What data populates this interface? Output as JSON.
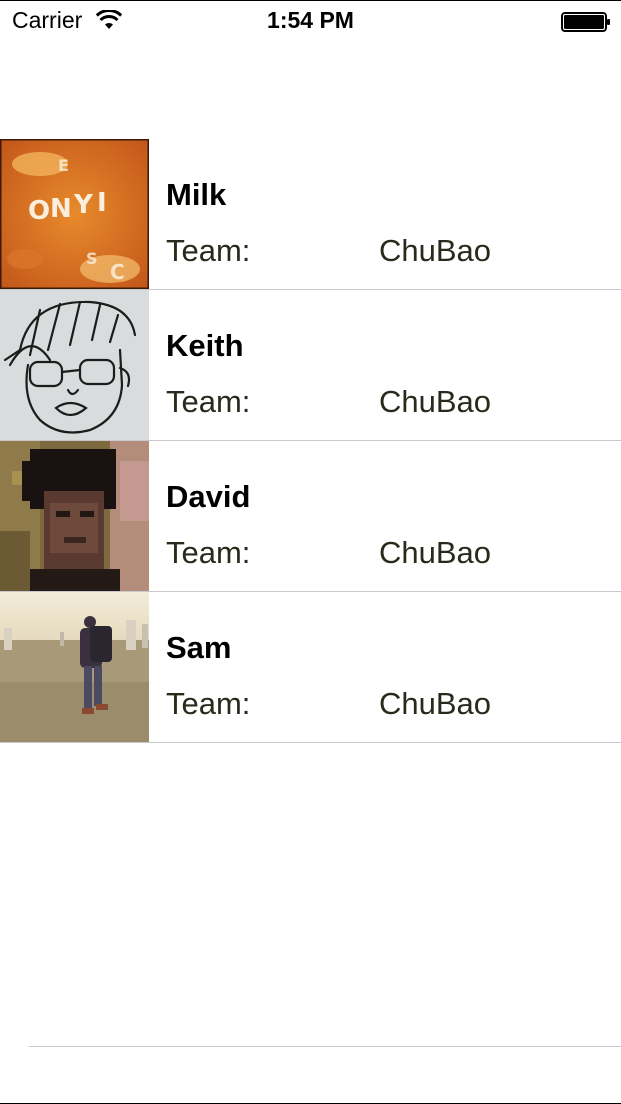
{
  "status_bar": {
    "carrier": "Carrier",
    "time": "1:54 PM",
    "icons": [
      "wifi-icon",
      "battery-icon"
    ]
  },
  "team_label": "Team:",
  "members": [
    {
      "name": "Milk",
      "team": "ChuBao",
      "avatar": "alphabet-soup-photo"
    },
    {
      "name": "Keith",
      "team": "ChuBao",
      "avatar": "face-sketch-drawing"
    },
    {
      "name": "David",
      "team": "ChuBao",
      "avatar": "pixelated-portrait-photo"
    },
    {
      "name": "Sam",
      "team": "ChuBao",
      "avatar": "hiker-field-photo"
    }
  ],
  "colors": {
    "separator": "#c8c7cc",
    "team_text": "#2a2a1c"
  }
}
